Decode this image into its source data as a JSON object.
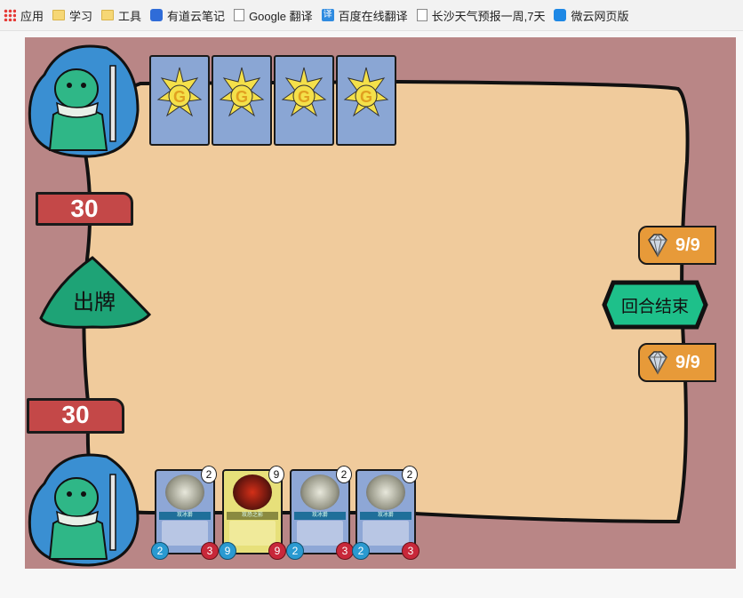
{
  "bookmarks": [
    {
      "label": "应用",
      "icon": "apps-grid-icon"
    },
    {
      "label": "学习",
      "icon": "folder-icon"
    },
    {
      "label": "工具",
      "icon": "folder-icon"
    },
    {
      "label": "有道云笔记",
      "icon": "youdao-icon"
    },
    {
      "label": "Google 翻译",
      "icon": "page-icon"
    },
    {
      "label": "百度在线翻译",
      "icon": "translate-icon"
    },
    {
      "label": "长沙天气预报一周,7天",
      "icon": "page-icon"
    },
    {
      "label": "微云网页版",
      "icon": "cloud-icon"
    }
  ],
  "game": {
    "opponent": {
      "hp": "30",
      "mana": "9/9",
      "deck_card_letter": "G",
      "deck_cards_visible": 4
    },
    "player": {
      "hp": "30",
      "mana": "9/9"
    },
    "play_button_label": "出牌",
    "end_turn_label": "回合结束",
    "hand": [
      {
        "name": "玫冰爵",
        "cost": "2",
        "attack": "2",
        "health": "3",
        "style": "blue",
        "art": "#9a9a8a"
      },
      {
        "name": "玫恐之影",
        "cost": "9",
        "attack": "9",
        "health": "9",
        "style": "yellow",
        "art": "#7a1a10"
      },
      {
        "name": "玫冰爵",
        "cost": "2",
        "attack": "2",
        "health": "3",
        "style": "blue",
        "art": "#9a9a8a"
      },
      {
        "name": "玫冰爵",
        "cost": "2",
        "attack": "2",
        "health": "3",
        "style": "blue",
        "art": "#9a9a8a"
      }
    ],
    "colors": {
      "board": "#f0cb9c",
      "frame": "#b98686",
      "hp": "#c44848",
      "mana": "#e79a39",
      "button": "#1ec08a"
    }
  }
}
